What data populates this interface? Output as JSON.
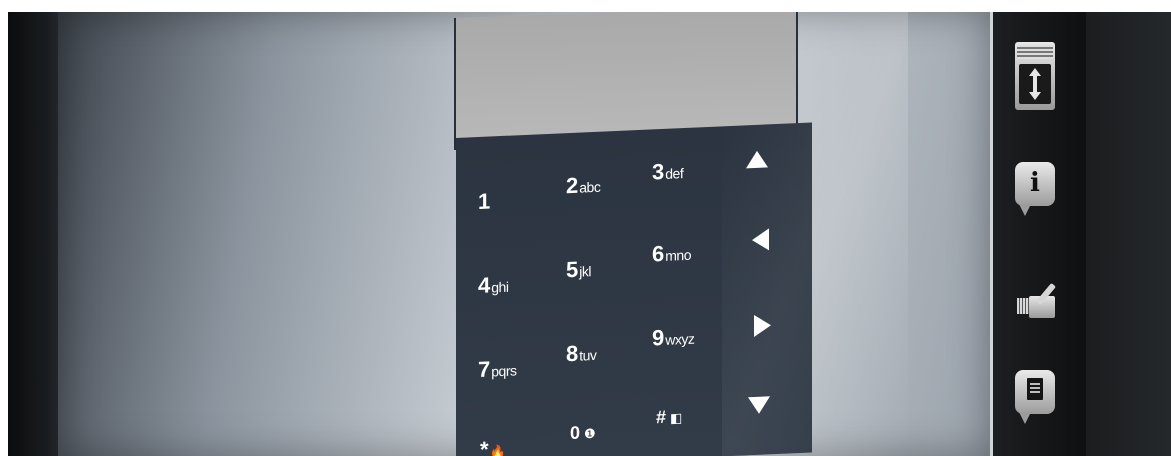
{
  "keypad": {
    "keys": [
      {
        "digit": "1",
        "letters": ""
      },
      {
        "digit": "2",
        "letters": "abc"
      },
      {
        "digit": "3",
        "letters": "def"
      },
      {
        "digit": "4",
        "letters": "ghi"
      },
      {
        "digit": "5",
        "letters": "jkl"
      },
      {
        "digit": "6",
        "letters": "mno"
      },
      {
        "digit": "7",
        "letters": "pqrs"
      },
      {
        "digit": "8",
        "letters": "tuv"
      },
      {
        "digit": "9",
        "letters": "wxyz"
      },
      {
        "digit": "*",
        "letters": "🔥"
      },
      {
        "digit": "0",
        "letters": "❶"
      },
      {
        "digit": "#",
        "letters": "◧"
      }
    ],
    "arrows": [
      "up",
      "left",
      "right",
      "down"
    ]
  },
  "sidebar": {
    "items": [
      {
        "icon": "scroll-icon"
      },
      {
        "icon": "info-icon",
        "glyph": "i"
      },
      {
        "icon": "camera-icon"
      },
      {
        "icon": "document-icon"
      }
    ]
  },
  "colors": {
    "keypad_bg": "#2e3844",
    "display_bg": "#b2b2b2",
    "key_text": "#ffffff"
  }
}
